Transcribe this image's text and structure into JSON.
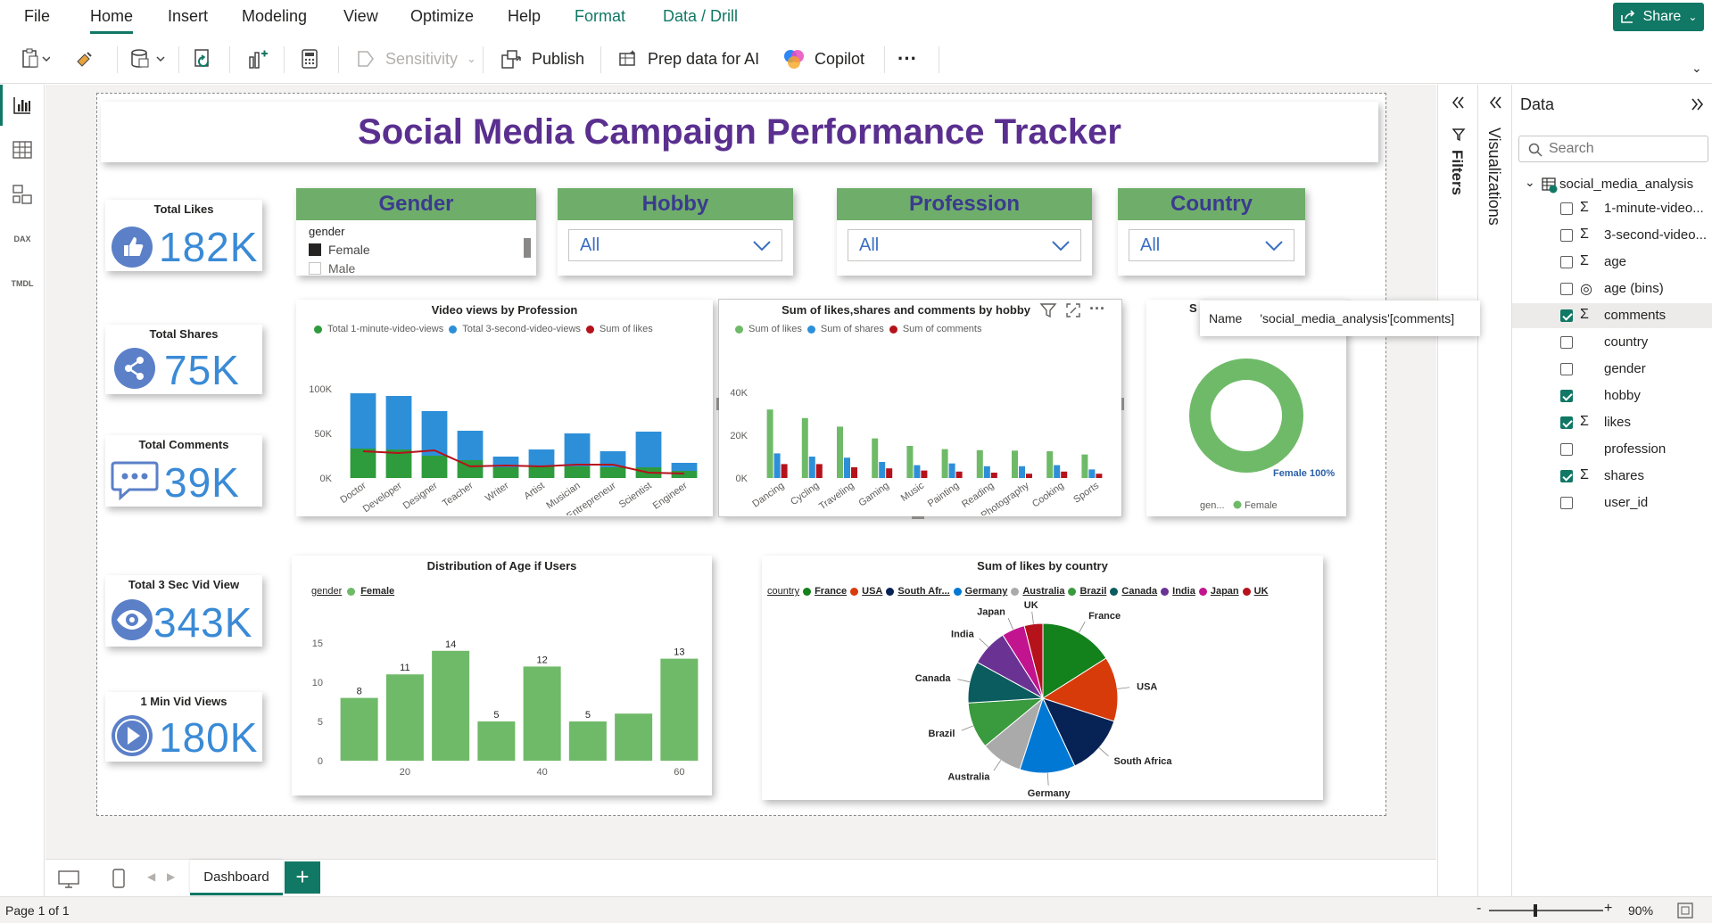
{
  "menu": {
    "tabs": [
      "File",
      "Home",
      "Insert",
      "Modeling",
      "View",
      "Optimize",
      "Help",
      "Format",
      "Data / Drill"
    ],
    "share": "Share"
  },
  "toolbar": {
    "sensitivity": "Sensitivity",
    "publish": "Publish",
    "prep": "Prep data for AI",
    "copilot": "Copilot",
    "more": "···"
  },
  "rail": {
    "dax": "DAX",
    "tmdl": "TMDL"
  },
  "report": {
    "title": "Social Media Campaign Performance Tracker",
    "kpis": [
      {
        "title": "Total Likes",
        "value": "182K",
        "icon": "thumbs-up-icon"
      },
      {
        "title": "Total Shares",
        "value": "75K",
        "icon": "share-icon"
      },
      {
        "title": "Total Comments",
        "value": "39K",
        "icon": "comment-icon"
      },
      {
        "title": "Total 3 Sec Vid View",
        "value": "343K",
        "icon": "eye-icon"
      },
      {
        "title": "1 Min Vid Views",
        "value": "180K",
        "icon": "play-icon"
      }
    ],
    "slicers": {
      "gender": {
        "title": "Gender",
        "field": "gender",
        "options": [
          "Female",
          "Male"
        ]
      },
      "hobby": {
        "title": "Hobby",
        "value": "All"
      },
      "profession": {
        "title": "Profession",
        "value": "All"
      },
      "country": {
        "title": "Country",
        "value": "All"
      }
    },
    "tooltip": {
      "label": "Name",
      "value": "'social_media_analysis'[comments]"
    }
  },
  "chart_data": [
    {
      "type": "bar",
      "title": "Video views by Profession",
      "categories": [
        "Doctor",
        "Developer",
        "Designer",
        "Teacher",
        "Writer",
        "Artist",
        "Musician",
        "Entrepreneur",
        "Scientist",
        "Engineer"
      ],
      "series": [
        {
          "name": "Total  1-minute-video-views",
          "values": [
            33000,
            32000,
            25000,
            20000,
            12000,
            14000,
            13000,
            12000,
            12000,
            8000
          ]
        },
        {
          "name": "Total 3-second-video-views",
          "values": [
            62000,
            60000,
            50000,
            33000,
            12000,
            18000,
            37000,
            18000,
            40000,
            9000
          ]
        },
        {
          "name": "Sum of likes",
          "values": [
            30000,
            28000,
            31000,
            13000,
            14000,
            13000,
            15000,
            15000,
            6000,
            5000
          ]
        }
      ],
      "colors": [
        "#2e9b3c",
        "#2e8fd9",
        "#b5121b"
      ],
      "yticks": [
        "0K",
        "50K",
        "100K"
      ],
      "ylim": [
        0,
        100000
      ]
    },
    {
      "type": "bar",
      "title": "Sum of likes,shares and comments by hobby",
      "categories": [
        "Dancing",
        "Cycling",
        "Traveling",
        "Gaming",
        "Music",
        "Painting",
        "Reading",
        "Photography",
        "Cooking",
        "Sports"
      ],
      "series": [
        {
          "name": "Sum of likes",
          "values": [
            32000,
            28000,
            24000,
            18500,
            15000,
            13500,
            13000,
            12800,
            12500,
            11000
          ]
        },
        {
          "name": "Sum of shares",
          "values": [
            11500,
            10000,
            9500,
            7500,
            6000,
            6800,
            5500,
            5500,
            6000,
            4000
          ]
        },
        {
          "name": "Sum of comments",
          "values": [
            6500,
            6500,
            5000,
            4500,
            3500,
            3000,
            2500,
            2000,
            3000,
            2000
          ]
        }
      ],
      "colors": [
        "#6fba68",
        "#2e8fd9",
        "#b5121b"
      ],
      "yticks": [
        "0K",
        "20K",
        "40K"
      ],
      "ylim": [
        0,
        40000
      ]
    },
    {
      "type": "pie",
      "title": "S",
      "slices": [
        {
          "label": "Female",
          "value": 100
        }
      ],
      "data_label": "Female 100%",
      "legend_title": "gen...",
      "colors": [
        "#6fba68"
      ]
    },
    {
      "type": "bar",
      "title": "Distribution of Age if Users",
      "legend_title": "gender",
      "series_name": "Female",
      "values": [
        8,
        11,
        14,
        5,
        12,
        5,
        6,
        13
      ],
      "data_labels": [
        "8",
        "11",
        "14",
        "5",
        "12",
        "5",
        "",
        "13"
      ],
      "yticks": [
        "0",
        "5",
        "10",
        "15"
      ],
      "xticks": [
        "20",
        "40",
        "60"
      ],
      "ylim": [
        0,
        15
      ],
      "color": "#6fba68"
    },
    {
      "type": "pie",
      "title": "Sum of likes by country",
      "legend_title": "country",
      "legend": [
        "France",
        "USA",
        "South Afr...",
        "Germany",
        "Australia",
        "Brazil",
        "Canada",
        "India",
        "Japan",
        "UK"
      ],
      "slices": [
        {
          "label": "France",
          "value": 16,
          "color": "#13811c"
        },
        {
          "label": "USA",
          "value": 14,
          "color": "#d83b0a"
        },
        {
          "label": "South Africa",
          "value": 13,
          "color": "#072356"
        },
        {
          "label": "Germany",
          "value": 12,
          "color": "#0078d4"
        },
        {
          "label": "Australia",
          "value": 9,
          "color": "#aaaaaa"
        },
        {
          "label": "Brazil",
          "value": 10,
          "color": "#3a9a3e"
        },
        {
          "label": "Canada",
          "value": 9,
          "color": "#0b5c5e"
        },
        {
          "label": "India",
          "value": 8,
          "color": "#6a3393"
        },
        {
          "label": "Japan",
          "value": 5,
          "color": "#c2148f"
        },
        {
          "label": "UK",
          "value": 4,
          "color": "#b5121b"
        }
      ]
    }
  ],
  "panes": {
    "filters": "Filters",
    "visualizations": "Visualizations",
    "data_title": "Data",
    "search_placeholder": "Search",
    "table": "social_media_analysis",
    "fields": [
      {
        "name": "1-minute-video...",
        "sigma": true,
        "checked": false
      },
      {
        "name": "3-second-video...",
        "sigma": true,
        "checked": false
      },
      {
        "name": "age",
        "sigma": true,
        "checked": false
      },
      {
        "name": "age (bins)",
        "sigma": false,
        "bins": true,
        "checked": false
      },
      {
        "name": "comments",
        "sigma": true,
        "checked": true
      },
      {
        "name": "country",
        "sigma": false,
        "checked": false
      },
      {
        "name": "gender",
        "sigma": false,
        "checked": false
      },
      {
        "name": "hobby",
        "sigma": false,
        "checked": true
      },
      {
        "name": "likes",
        "sigma": true,
        "checked": true
      },
      {
        "name": "profession",
        "sigma": false,
        "checked": false
      },
      {
        "name": "shares",
        "sigma": true,
        "checked": true
      },
      {
        "name": "user_id",
        "sigma": false,
        "checked": false
      }
    ]
  },
  "pages": {
    "current": "Dashboard",
    "status": "Page 1 of 1",
    "zoom": "90%"
  }
}
